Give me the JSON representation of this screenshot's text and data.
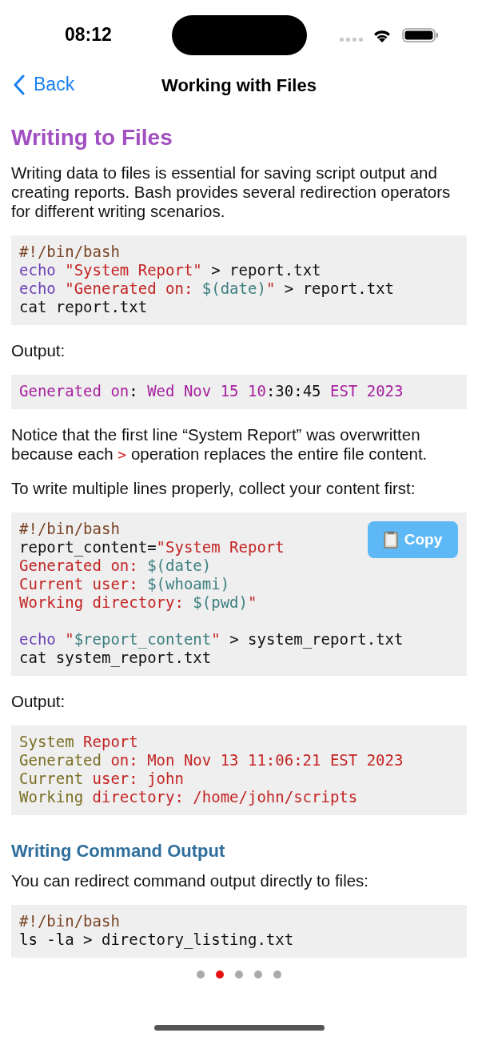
{
  "status_bar": {
    "time": "08:12"
  },
  "nav": {
    "back": "Back",
    "title": "Working with Files"
  },
  "content": [
    {
      "kind": "heading",
      "text": "Writing to Files"
    },
    {
      "kind": "paragraph",
      "segments": [
        {
          "kind": "plain",
          "text": "Writing data to files is essential for saving script output and creating reports. Bash provides several redirection operators for different writing scenarios."
        }
      ]
    },
    {
      "kind": "code",
      "groups": [
        [
          [
            {
              "kind": "comment",
              "text": "#!/bin/bash"
            }
          ],
          [
            {
              "kind": "keyword",
              "text": "echo"
            },
            {
              "kind": "string",
              "text": " \"System Report\""
            },
            {
              "kind": "plain",
              "text": " > report.txt"
            }
          ],
          [
            {
              "kind": "keyword",
              "text": "echo"
            },
            {
              "kind": "string",
              "text": " \"Generated on: "
            },
            {
              "kind": "subst",
              "text": "$(date)"
            },
            {
              "kind": "string",
              "text": "\""
            },
            {
              "kind": "plain",
              "text": " > report.txt"
            }
          ],
          [
            {
              "kind": "plain",
              "text": "cat report.txt"
            }
          ]
        ]
      ]
    },
    {
      "kind": "paragraph",
      "segments": [
        {
          "kind": "plain",
          "text": "Output:"
        }
      ]
    },
    {
      "kind": "code",
      "groups": [
        [
          [
            {
              "kind": "magenta",
              "text": "Generated on"
            },
            {
              "kind": "plain",
              "text": ": "
            },
            {
              "kind": "magenta",
              "text": "Wed Nov 15 10"
            },
            {
              "kind": "plain",
              "text": ":30:45 "
            },
            {
              "kind": "magenta",
              "text": "EST 2023"
            }
          ]
        ]
      ]
    },
    {
      "kind": "paragraph",
      "segments": [
        {
          "kind": "plain",
          "text": "Notice that the first line “System Report” was overwritten because each "
        },
        {
          "kind": "code",
          "text": ">"
        },
        {
          "kind": "plain",
          "text": " operation replaces the entire file content."
        }
      ]
    },
    {
      "kind": "paragraph",
      "segments": [
        {
          "kind": "plain",
          "text": "To write multiple lines properly, collect your content first:"
        }
      ]
    },
    {
      "kind": "code",
      "copy_button": "Copy",
      "groups": [
        [
          [
            {
              "kind": "comment",
              "text": "#!/bin/bash"
            }
          ],
          [
            {
              "kind": "plain",
              "text": "report_content="
            },
            {
              "kind": "string",
              "text": "\"System Report"
            }
          ],
          [
            {
              "kind": "string",
              "text": "Generated on: "
            },
            {
              "kind": "subst",
              "text": "$(date)"
            }
          ],
          [
            {
              "kind": "string",
              "text": "Current user: "
            },
            {
              "kind": "subst",
              "text": "$(whoami)"
            }
          ],
          [
            {
              "kind": "string",
              "text": "Working directory: "
            },
            {
              "kind": "subst",
              "text": "$(pwd)"
            },
            {
              "kind": "string",
              "text": "\""
            }
          ]
        ],
        [
          [
            {
              "kind": "keyword",
              "text": "echo"
            },
            {
              "kind": "string",
              "text": " \""
            },
            {
              "kind": "subst",
              "text": "$report_content"
            },
            {
              "kind": "string",
              "text": "\""
            },
            {
              "kind": "plain",
              "text": " > system_report.txt"
            }
          ],
          [
            {
              "kind": "plain",
              "text": "cat system_report.txt"
            }
          ]
        ]
      ]
    },
    {
      "kind": "paragraph",
      "segments": [
        {
          "kind": "plain",
          "text": "Output:"
        }
      ]
    },
    {
      "kind": "code",
      "groups": [
        [
          [
            {
              "kind": "olive",
              "text": "System"
            },
            {
              "kind": "string",
              "text": " Report"
            }
          ],
          [
            {
              "kind": "olive",
              "text": "Generated"
            },
            {
              "kind": "string",
              "text": " on: Mon Nov 13 11:06:21 EST 2023"
            }
          ],
          [
            {
              "kind": "olive",
              "text": "Current"
            },
            {
              "kind": "string",
              "text": " user: john"
            }
          ],
          [
            {
              "kind": "olive",
              "text": "Working"
            },
            {
              "kind": "string",
              "text": " directory: /home/john/scripts"
            }
          ]
        ]
      ]
    },
    {
      "kind": "subheading",
      "text": "Writing Command Output"
    },
    {
      "kind": "paragraph",
      "segments": [
        {
          "kind": "plain",
          "text": "You can redirect command output directly to files:"
        }
      ]
    },
    {
      "kind": "code",
      "groups": [
        [
          [
            {
              "kind": "comment",
              "text": "#!/bin/bash"
            }
          ],
          [
            {
              "kind": "plain",
              "text": "ls -la > directory_listing.txt"
            }
          ]
        ]
      ]
    }
  ],
  "page_dots": [
    {
      "selected": false
    },
    {
      "selected": true
    },
    {
      "selected": false
    },
    {
      "selected": false
    },
    {
      "selected": false
    }
  ]
}
